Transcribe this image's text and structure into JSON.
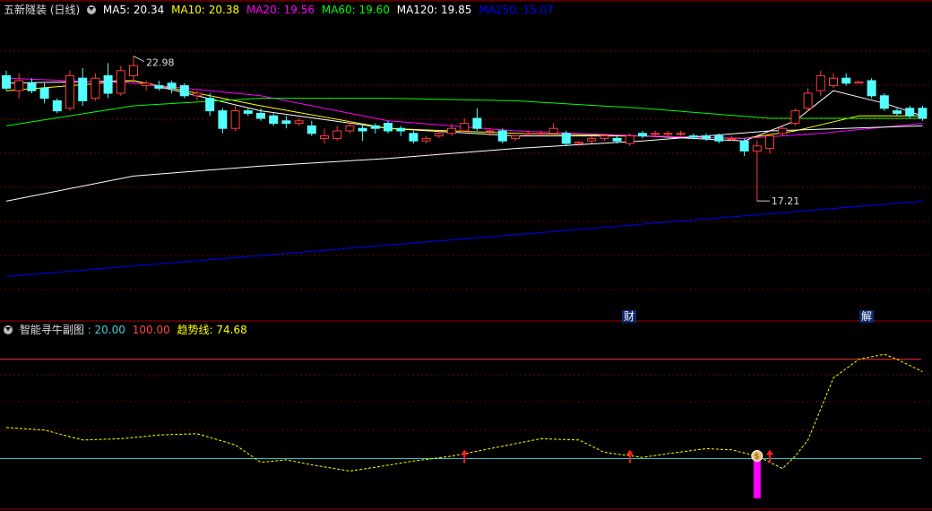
{
  "main_panel": {
    "stock_name": "五新隧装 (日线)",
    "indicators": [
      {
        "label": "MA5: 20.34",
        "color": "#ffffff"
      },
      {
        "label": "MA10: 20.38",
        "color": "#ffff00"
      },
      {
        "label": "MA20: 19.56",
        "color": "#ff00ff"
      },
      {
        "label": "MA60: 19.60",
        "color": "#00ff00"
      },
      {
        "label": "MA120: 19.85",
        "color": "#ffffff"
      },
      {
        "label": "MA250: 15.07",
        "color": "#0000ff"
      }
    ],
    "high_label": "22.98",
    "low_label": "17.21",
    "markers": [
      {
        "text": "财"
      },
      {
        "text": "解"
      }
    ]
  },
  "sub_panel": {
    "title": "智能寻牛副图",
    "level_low": ": 20.00",
    "level_high": "100.00",
    "trend_label": "趋势线: 74.68"
  },
  "colors": {
    "up": "#ff3b3b",
    "down": "#54ffff",
    "grid": "#7a0000",
    "border": "#a00000",
    "accent_bar": "#ff00ff"
  },
  "chart_data": [
    {
      "type": "candlestick",
      "title": "五新隧装 (日线)",
      "ylim": [
        13,
        24.5
      ],
      "candles": [
        {
          "o": 22.2,
          "h": 22.4,
          "l": 21.6,
          "c": 21.7
        },
        {
          "o": 21.6,
          "h": 22.3,
          "l": 21.3,
          "c": 22.0
        },
        {
          "o": 21.9,
          "h": 22.1,
          "l": 21.5,
          "c": 21.6
        },
        {
          "o": 21.7,
          "h": 21.9,
          "l": 21.1,
          "c": 21.3
        },
        {
          "o": 21.2,
          "h": 21.3,
          "l": 20.7,
          "c": 20.8
        },
        {
          "o": 20.9,
          "h": 22.4,
          "l": 20.8,
          "c": 22.2
        },
        {
          "o": 22.1,
          "h": 22.5,
          "l": 21.0,
          "c": 21.2
        },
        {
          "o": 21.3,
          "h": 22.3,
          "l": 21.2,
          "c": 22.1
        },
        {
          "o": 22.2,
          "h": 22.7,
          "l": 21.3,
          "c": 21.5
        },
        {
          "o": 21.5,
          "h": 22.6,
          "l": 21.4,
          "c": 22.4
        },
        {
          "o": 22.2,
          "h": 22.98,
          "l": 21.9,
          "c": 22.6
        },
        {
          "o": 21.8,
          "h": 22.0,
          "l": 21.6,
          "c": 21.9
        },
        {
          "o": 21.8,
          "h": 22.0,
          "l": 21.6,
          "c": 21.7
        },
        {
          "o": 21.9,
          "h": 22.0,
          "l": 21.5,
          "c": 21.7
        },
        {
          "o": 21.8,
          "h": 21.9,
          "l": 21.3,
          "c": 21.4
        },
        {
          "o": 21.4,
          "h": 21.6,
          "l": 21.2,
          "c": 21.5
        },
        {
          "o": 21.3,
          "h": 21.5,
          "l": 20.6,
          "c": 20.8
        },
        {
          "o": 20.8,
          "h": 20.9,
          "l": 19.9,
          "c": 20.1
        },
        {
          "o": 20.1,
          "h": 21.0,
          "l": 20.0,
          "c": 20.8
        },
        {
          "o": 20.8,
          "h": 20.9,
          "l": 20.6,
          "c": 20.7
        },
        {
          "o": 20.7,
          "h": 20.9,
          "l": 20.4,
          "c": 20.5
        },
        {
          "o": 20.6,
          "h": 20.7,
          "l": 20.2,
          "c": 20.3
        },
        {
          "o": 20.4,
          "h": 20.6,
          "l": 20.1,
          "c": 20.3
        },
        {
          "o": 20.3,
          "h": 20.5,
          "l": 20.2,
          "c": 20.4
        },
        {
          "o": 20.2,
          "h": 20.4,
          "l": 19.8,
          "c": 19.9
        },
        {
          "o": 19.7,
          "h": 20.1,
          "l": 19.5,
          "c": 19.8
        },
        {
          "o": 19.7,
          "h": 20.2,
          "l": 19.6,
          "c": 20.0
        },
        {
          "o": 20.0,
          "h": 20.4,
          "l": 19.9,
          "c": 20.2
        },
        {
          "o": 20.1,
          "h": 20.3,
          "l": 19.6,
          "c": 20.0
        },
        {
          "o": 20.2,
          "h": 20.3,
          "l": 19.9,
          "c": 20.1
        },
        {
          "o": 20.3,
          "h": 20.4,
          "l": 19.9,
          "c": 20.0
        },
        {
          "o": 20.1,
          "h": 20.2,
          "l": 19.8,
          "c": 20.0
        },
        {
          "o": 19.9,
          "h": 20.0,
          "l": 19.5,
          "c": 19.6
        },
        {
          "o": 19.6,
          "h": 19.8,
          "l": 19.5,
          "c": 19.7
        },
        {
          "o": 19.8,
          "h": 20.0,
          "l": 19.7,
          "c": 19.9
        },
        {
          "o": 19.9,
          "h": 20.3,
          "l": 19.8,
          "c": 20.1
        },
        {
          "o": 20.0,
          "h": 20.5,
          "l": 19.9,
          "c": 20.3
        },
        {
          "o": 20.5,
          "h": 20.9,
          "l": 20.0,
          "c": 20.1
        },
        {
          "o": 20.0,
          "h": 20.1,
          "l": 19.8,
          "c": 20.0
        },
        {
          "o": 20.0,
          "h": 20.1,
          "l": 19.5,
          "c": 19.6
        },
        {
          "o": 19.7,
          "h": 19.8,
          "l": 19.6,
          "c": 19.8
        },
        {
          "o": 19.9,
          "h": 20.0,
          "l": 19.8,
          "c": 19.9
        },
        {
          "o": 19.9,
          "h": 20.0,
          "l": 19.8,
          "c": 19.9
        },
        {
          "o": 19.9,
          "h": 20.3,
          "l": 19.8,
          "c": 20.1
        },
        {
          "o": 19.9,
          "h": 20.0,
          "l": 19.4,
          "c": 19.5
        },
        {
          "o": 19.5,
          "h": 19.6,
          "l": 19.4,
          "c": 19.55
        },
        {
          "o": 19.6,
          "h": 19.8,
          "l": 19.5,
          "c": 19.7
        },
        {
          "o": 19.7,
          "h": 19.8,
          "l": 19.6,
          "c": 19.8
        },
        {
          "o": 19.7,
          "h": 19.8,
          "l": 19.5,
          "c": 19.6
        },
        {
          "o": 19.5,
          "h": 19.9,
          "l": 19.4,
          "c": 19.8
        },
        {
          "o": 19.9,
          "h": 20.0,
          "l": 19.7,
          "c": 19.8
        },
        {
          "o": 19.9,
          "h": 20.0,
          "l": 19.8,
          "c": 19.9
        },
        {
          "o": 19.9,
          "h": 20.0,
          "l": 19.8,
          "c": 19.9
        },
        {
          "o": 19.9,
          "h": 20.0,
          "l": 19.8,
          "c": 19.9
        },
        {
          "o": 19.8,
          "h": 19.9,
          "l": 19.7,
          "c": 19.75
        },
        {
          "o": 19.8,
          "h": 19.9,
          "l": 19.6,
          "c": 19.7
        },
        {
          "o": 19.8,
          "h": 19.9,
          "l": 19.5,
          "c": 19.6
        },
        {
          "o": 19.7,
          "h": 19.8,
          "l": 19.6,
          "c": 19.7
        },
        {
          "o": 19.6,
          "h": 19.7,
          "l": 19.0,
          "c": 19.2
        },
        {
          "o": 19.2,
          "h": 19.6,
          "l": 17.21,
          "c": 19.4
        },
        {
          "o": 19.3,
          "h": 19.9,
          "l": 19.1,
          "c": 19.8
        },
        {
          "o": 19.9,
          "h": 20.2,
          "l": 19.8,
          "c": 20.1
        },
        {
          "o": 20.3,
          "h": 20.9,
          "l": 20.2,
          "c": 20.8
        },
        {
          "o": 20.9,
          "h": 21.7,
          "l": 20.8,
          "c": 21.5
        },
        {
          "o": 21.6,
          "h": 22.4,
          "l": 21.4,
          "c": 22.2
        },
        {
          "o": 21.8,
          "h": 22.3,
          "l": 21.7,
          "c": 22.1
        },
        {
          "o": 22.1,
          "h": 22.3,
          "l": 21.8,
          "c": 21.9
        },
        {
          "o": 21.9,
          "h": 22.0,
          "l": 21.9,
          "c": 21.95
        },
        {
          "o": 22.0,
          "h": 22.1,
          "l": 21.3,
          "c": 21.4
        },
        {
          "o": 21.4,
          "h": 21.5,
          "l": 20.8,
          "c": 20.9
        },
        {
          "o": 20.8,
          "h": 20.9,
          "l": 20.6,
          "c": 20.7
        },
        {
          "o": 20.9,
          "h": 21.0,
          "l": 20.5,
          "c": 20.6
        },
        {
          "o": 20.9,
          "h": 21.0,
          "l": 20.4,
          "c": 20.5
        }
      ],
      "series": [
        {
          "name": "MA5",
          "color": "#ffffff",
          "values": [
            [
              0,
              21.9
            ],
            [
              10,
              22.0
            ],
            [
              20,
              20.8
            ],
            [
              30,
              20.1
            ],
            [
              40,
              19.8
            ],
            [
              50,
              19.8
            ],
            [
              58,
              19.6
            ],
            [
              62,
              20.4
            ],
            [
              65,
              21.6
            ],
            [
              69,
              21.1
            ],
            [
              72,
              20.6
            ]
          ]
        },
        {
          "name": "MA10",
          "color": "#ffff00",
          "values": [
            [
              0,
              21.6
            ],
            [
              10,
              22.0
            ],
            [
              20,
              21.0
            ],
            [
              30,
              20.1
            ],
            [
              40,
              19.9
            ],
            [
              50,
              19.8
            ],
            [
              58,
              19.7
            ],
            [
              62,
              20.0
            ],
            [
              67,
              20.6
            ],
            [
              72,
              20.6
            ]
          ]
        },
        {
          "name": "MA20",
          "color": "#ff00ff",
          "values": [
            [
              0,
              22.1
            ],
            [
              10,
              21.9
            ],
            [
              20,
              21.4
            ],
            [
              30,
              20.4
            ],
            [
              40,
              20.0
            ],
            [
              50,
              19.8
            ],
            [
              58,
              19.7
            ],
            [
              64,
              19.9
            ],
            [
              72,
              20.3
            ]
          ]
        },
        {
          "name": "MA60",
          "color": "#00ff00",
          "values": [
            [
              0,
              20.2
            ],
            [
              10,
              21.0
            ],
            [
              20,
              21.3
            ],
            [
              30,
              21.3
            ],
            [
              40,
              21.2
            ],
            [
              50,
              20.9
            ],
            [
              60,
              20.5
            ],
            [
              72,
              20.5
            ]
          ]
        },
        {
          "name": "MA120",
          "color": "#ffffff",
          "values": [
            [
              0,
              17.2
            ],
            [
              10,
              18.2
            ],
            [
              20,
              18.6
            ],
            [
              30,
              18.9
            ],
            [
              40,
              19.3
            ],
            [
              50,
              19.6
            ],
            [
              60,
              20.0
            ],
            [
              72,
              20.2
            ]
          ]
        },
        {
          "name": "MA250",
          "color": "#0000ff",
          "values": [
            [
              0,
              14.2
            ],
            [
              72,
              17.2
            ]
          ]
        }
      ]
    },
    {
      "type": "line",
      "title": "智能寻牛副图",
      "ylim": [
        -15,
        115
      ],
      "levels": [
        20,
        100
      ],
      "series": [
        {
          "name": "趋势线",
          "color": "#ffff00",
          "values": [
            [
              0,
              45
            ],
            [
              3,
              43
            ],
            [
              6,
              35
            ],
            [
              9,
              36
            ],
            [
              12,
              39
            ],
            [
              15,
              40
            ],
            [
              18,
              31
            ],
            [
              20,
              17
            ],
            [
              22,
              19
            ],
            [
              24,
              15
            ],
            [
              27,
              10
            ],
            [
              29,
              13
            ],
            [
              32,
              18
            ],
            [
              35,
              22
            ],
            [
              36,
              24
            ],
            [
              39,
              30
            ],
            [
              42,
              36
            ],
            [
              45,
              35
            ],
            [
              47,
              25
            ],
            [
              50,
              21
            ],
            [
              52,
              24
            ],
            [
              55,
              28
            ],
            [
              57,
              27
            ],
            [
              59,
              22
            ],
            [
              61,
              12
            ],
            [
              62,
              22
            ],
            [
              63,
              35
            ],
            [
              64,
              60
            ],
            [
              65,
              85
            ],
            [
              67,
              100
            ],
            [
              69,
              104
            ],
            [
              70,
              100
            ],
            [
              72,
              90
            ]
          ]
        }
      ],
      "signals": [
        {
          "type": "red-arrow",
          "x": 36
        },
        {
          "type": "red-arrow",
          "x": 49
        },
        {
          "type": "money-bag",
          "x": 59
        },
        {
          "type": "red-arrow",
          "x": 60
        }
      ],
      "bars": [
        {
          "x": 59,
          "from": 20,
          "to": -12,
          "color": "#ff00ff"
        }
      ]
    }
  ]
}
